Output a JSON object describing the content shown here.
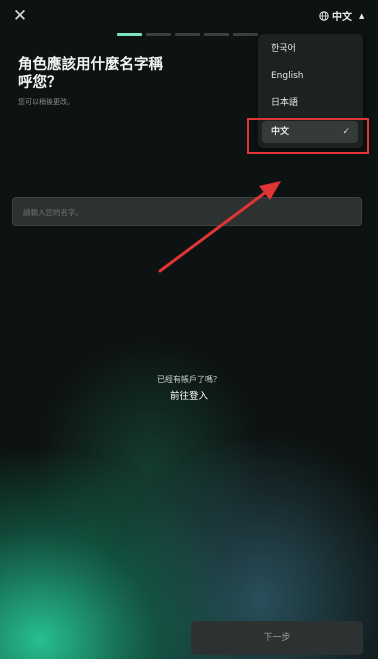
{
  "header": {
    "close_glyph": "✕",
    "language_label": "中文",
    "progress": {
      "total_steps": 5,
      "current_step": 1
    }
  },
  "main": {
    "title": "角色應該用什麼名字稱呼您？",
    "subtitle": "您可以稍後更改。",
    "name_input": {
      "placeholder": "請輸入您的名字。",
      "value": ""
    },
    "account_question": "已經有帳戶了嗎？",
    "login_link": "前往登入"
  },
  "language_menu": {
    "items": [
      {
        "label": "한국어",
        "selected": false
      },
      {
        "label": "English",
        "selected": false
      },
      {
        "label": "日本語",
        "selected": false
      },
      {
        "label": "中文",
        "selected": true
      }
    ]
  },
  "footer": {
    "next_button": "下一步"
  },
  "colors": {
    "accent": "#7fe0c2",
    "annotation": "#e03535",
    "background": "#0d1312",
    "glow": "#28c896"
  },
  "icons": {
    "close": "close-icon",
    "language": "globe-icon",
    "dropdown": "caret-up-icon",
    "selected": "check-icon"
  }
}
